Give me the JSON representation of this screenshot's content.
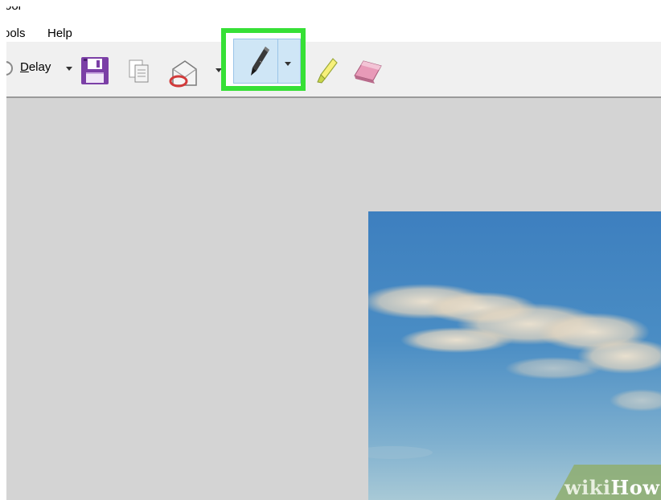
{
  "window": {
    "title": "ool"
  },
  "menu": {
    "tools": "ools",
    "help": "Help"
  },
  "toolbar": {
    "delay_label_accel": "D",
    "delay_label_rest": "elay",
    "icons": {
      "delay": "clock-icon",
      "save": "floppy-disk-icon",
      "copy": "copy-icon",
      "send": "send-email-icon",
      "pen": "pen-icon",
      "highlighter": "highlighter-icon",
      "eraser": "eraser-icon"
    },
    "selected_tool": "pen"
  },
  "colors": {
    "callout_highlight": "#36e036",
    "selected_button_bg": "#cfe6f6",
    "toolbar_bg": "#f0f0f0",
    "canvas_bg": "#d4d4d4"
  },
  "watermark": {
    "part1": "wiki",
    "part2": "How"
  }
}
